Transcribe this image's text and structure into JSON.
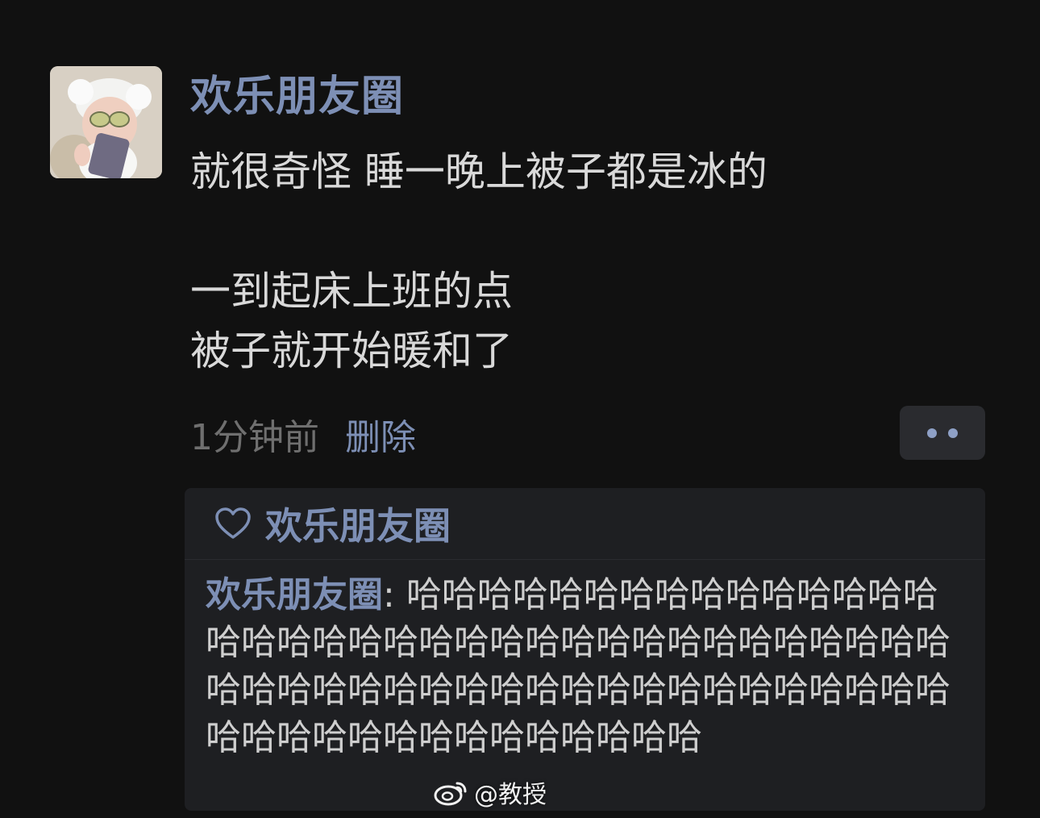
{
  "post": {
    "author": "欢乐朋友圈",
    "avatar_icon": "baby-avatar-photo",
    "text": "就很奇怪 睡一晚上被子都是冰的\n\n一到起床上班的点\n被子就开始暖和了",
    "time": "1分钟前",
    "delete_label": "删除",
    "more_icon": "more-dots-icon"
  },
  "likes": {
    "icon": "heart-outline-icon",
    "names": "欢乐朋友圈"
  },
  "comment": {
    "author": "欢乐朋友圈",
    "separator": ": ",
    "text": "哈哈哈哈哈哈哈哈哈哈哈哈哈哈哈哈哈哈哈哈哈哈哈哈哈哈哈哈哈哈哈哈哈哈哈哈哈哈哈哈哈哈哈哈哈哈哈哈哈哈哈哈哈哈哈哈哈哈哈哈哈哈哈哈哈哈哈哈哈哈哈"
  },
  "watermark": {
    "icon": "weibo-icon",
    "text": "@教授"
  },
  "colors": {
    "background": "#111111",
    "name_blue": "#7d8fb5",
    "comment_panel": "#1e1f22",
    "muted_text": "#6f6f6f"
  }
}
